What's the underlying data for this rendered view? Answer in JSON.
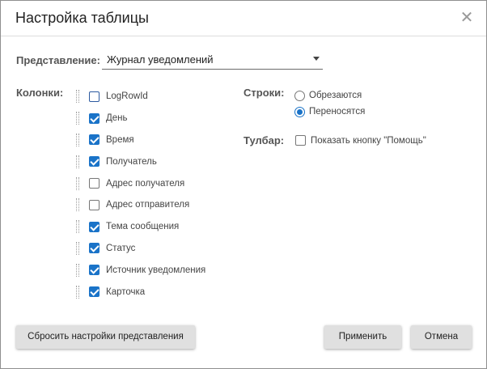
{
  "dialog": {
    "title": "Настройка таблицы",
    "close_glyph": "✕"
  },
  "view": {
    "label": "Представление:",
    "selected": "Журнал уведомлений"
  },
  "columns": {
    "label": "Колонки:",
    "items": [
      {
        "label": "LogRowId",
        "checked": false
      },
      {
        "label": "День",
        "checked": true
      },
      {
        "label": "Время",
        "checked": true
      },
      {
        "label": "Получатель",
        "checked": true
      },
      {
        "label": "Адрес получателя",
        "checked": false
      },
      {
        "label": "Адрес отправителя",
        "checked": false
      },
      {
        "label": "Тема сообщения",
        "checked": true
      },
      {
        "label": "Статус",
        "checked": true
      },
      {
        "label": "Источник уведомления",
        "checked": true
      },
      {
        "label": "Карточка",
        "checked": true
      }
    ]
  },
  "rows": {
    "label": "Строки:",
    "options": [
      {
        "label": "Обрезаются",
        "selected": false
      },
      {
        "label": "Переносятся",
        "selected": true
      }
    ]
  },
  "toolbar": {
    "label": "Тулбар:",
    "help_option": {
      "label": "Показать кнопку \"Помощь\"",
      "checked": false
    }
  },
  "buttons": {
    "reset": "Сбросить настройки представления",
    "apply": "Применить",
    "cancel": "Отмена"
  },
  "colors": {
    "accent": "#1a73c8",
    "button_bg": "#e0e0e0"
  }
}
